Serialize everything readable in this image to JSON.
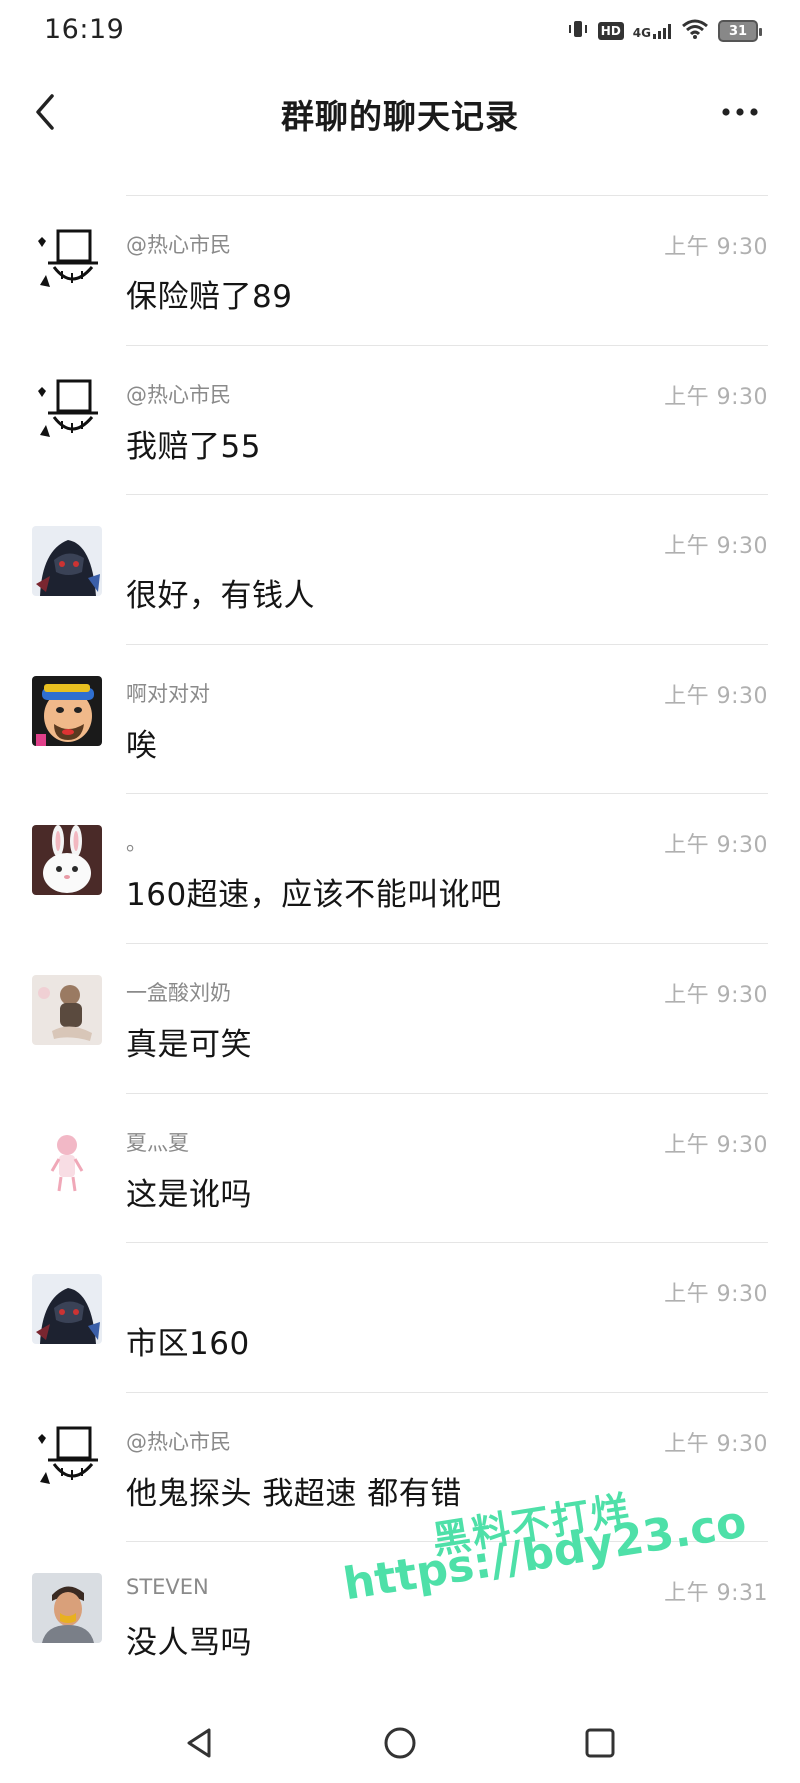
{
  "status_bar": {
    "time": "16:19",
    "hd": "HD",
    "network": "4G",
    "battery": "31"
  },
  "nav": {
    "title": "群聊的聊天记录"
  },
  "messages": [
    {
      "sender": "@热心市民",
      "time": "上午 9:30",
      "text": "保险赔了89",
      "avatar": "hat-sketch-avatar"
    },
    {
      "sender": "@热心市民",
      "time": "上午 9:30",
      "text": "我赔了55",
      "avatar": "hat-sketch-avatar"
    },
    {
      "sender": "",
      "time": "上午 9:30",
      "text": "很好，有钱人",
      "avatar": "hooded-figure-avatar"
    },
    {
      "sender": "啊对对对",
      "time": "上午 9:30",
      "text": "唉",
      "avatar": "cartoon-man-avatar"
    },
    {
      "sender": "。",
      "time": "上午 9:30",
      "text": "160超速，应该不能叫讹吧",
      "avatar": "white-rabbit-avatar"
    },
    {
      "sender": "一盒酸刘奶",
      "time": "上午 9:30",
      "text": "真是可笑",
      "avatar": "figure-photo-avatar"
    },
    {
      "sender": "夏灬夏",
      "time": "上午 9:30",
      "text": "这是讹吗",
      "avatar": "pink-doll-avatar"
    },
    {
      "sender": "",
      "time": "上午 9:30",
      "text": "市区160",
      "avatar": "hooded-figure-avatar"
    },
    {
      "sender": "@热心市民",
      "time": "上午 9:30",
      "text": "他鬼探头 我超速 都有错",
      "avatar": "hat-sketch-avatar"
    },
    {
      "sender": "STEVEN",
      "time": "上午 9:31",
      "text": "没人骂吗",
      "avatar": "portrait-avatar"
    }
  ],
  "watermark": {
    "line1": "黑料不打烊",
    "line2": "https://bdy23.co"
  },
  "colors": {
    "watermark": "#4ee0a8",
    "divider": "#e5e5e5",
    "timestamp": "#b0b0b0"
  }
}
